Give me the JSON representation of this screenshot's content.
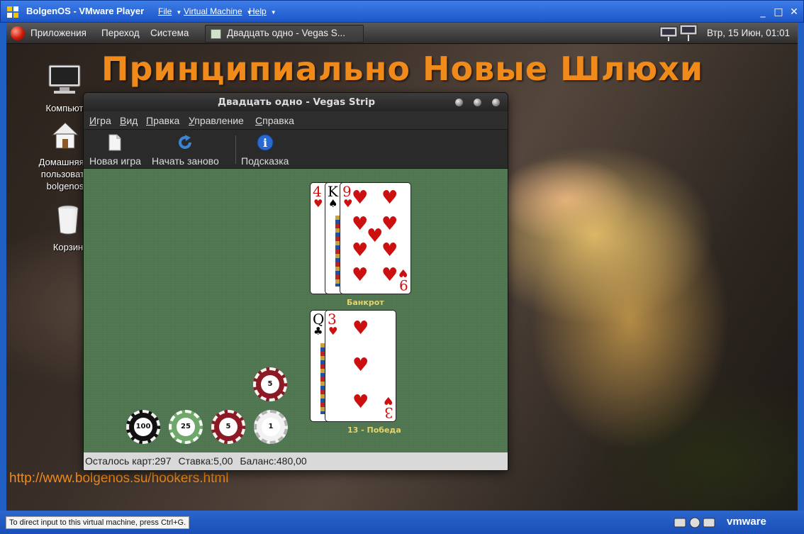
{
  "vmware": {
    "title": "BolgenOS - VMware Player",
    "menu": {
      "file": "File",
      "vm": "Virtual Machine",
      "help": "Help"
    },
    "window_controls": {
      "minimize": "_",
      "maximize": "□",
      "close": "✕"
    },
    "status_hint": "To direct input to this virtual machine, press Ctrl+G.",
    "brand": "vmware"
  },
  "guest_panel": {
    "menus": [
      "Приложения",
      "Переход",
      "Система"
    ],
    "task": "Двадцать одно - Vegas S...",
    "clock": "Втр, 15 Июн, 01:01"
  },
  "desktop": {
    "banner": "Принципиально Новые Шлюхи",
    "url": "http://www.bolgenos.su/hookers.html",
    "icons": [
      {
        "label": "Компьют",
        "icon": "computer-icon"
      },
      {
        "label": "Домашняя п пользовате bolgenos",
        "icon": "home-icon",
        "lines": [
          "Домашняя п",
          "пользовате",
          "bolgenos"
        ]
      },
      {
        "label": "Корзин",
        "icon": "trash-icon"
      }
    ]
  },
  "game": {
    "window_title": "Двадцать одно - Vegas Strip",
    "menu": [
      "Игра",
      "Вид",
      "Правка",
      "Управление",
      "Справка"
    ],
    "toolbar": {
      "new_game": "Новая игра",
      "restart": "Начать заново",
      "hint": "Подсказка"
    },
    "dealer": {
      "label": "Банкрот",
      "cards": [
        {
          "rank": "4",
          "suit": "♥",
          "color": "red"
        },
        {
          "rank": "K",
          "suit": "♠",
          "color": "black"
        },
        {
          "rank": "9",
          "suit": "♥",
          "color": "red"
        }
      ]
    },
    "player": {
      "label": "13 - Победа",
      "cards": [
        {
          "rank": "Q",
          "suit": "♣",
          "color": "black"
        },
        {
          "rank": "3",
          "suit": "♥",
          "color": "red"
        }
      ]
    },
    "bet_chip": {
      "value": "5",
      "color": "#8b1a24"
    },
    "chips": [
      {
        "value": "100",
        "color": "#111111"
      },
      {
        "value": "25",
        "color": "#6fa86a"
      },
      {
        "value": "5",
        "color": "#8b1a24"
      },
      {
        "value": "1",
        "color": "#f2f2f2"
      }
    ],
    "status": {
      "cards_left": "Осталось карт:297",
      "bet": "Ставка:5,00",
      "balance": "Баланс:480,00"
    }
  }
}
